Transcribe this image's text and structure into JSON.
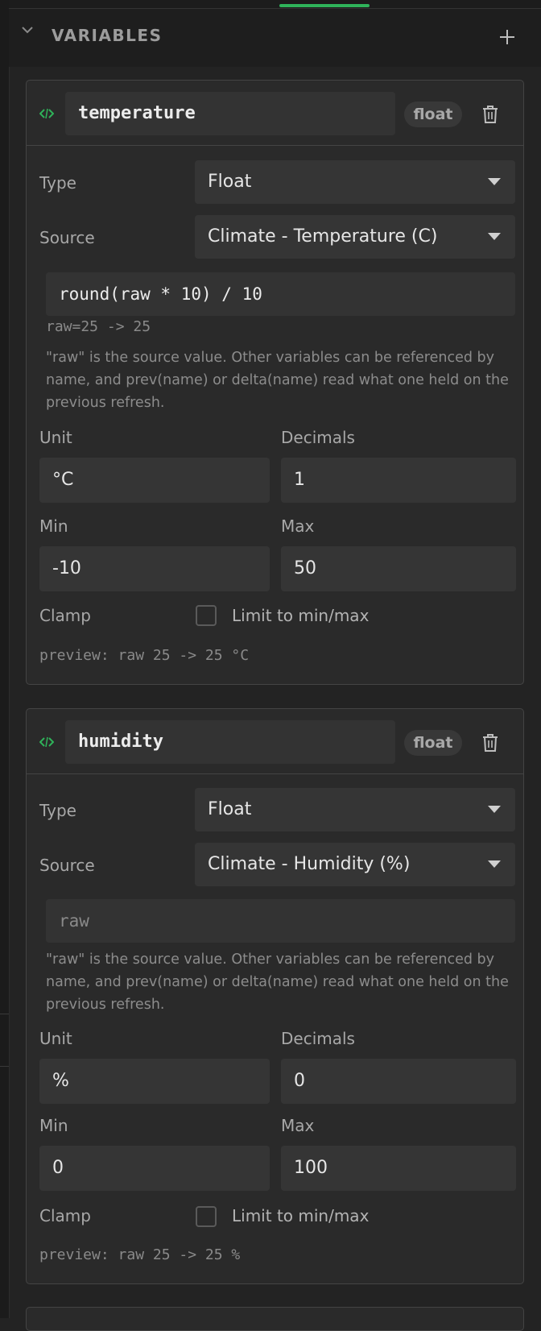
{
  "section": {
    "title": "VARIABLES"
  },
  "colors": {
    "accent": "#2fb35a"
  },
  "icons": {
    "collapse": "chevron-down-icon",
    "add": "plus-icon",
    "variable": "code-icon",
    "delete": "trash-icon"
  },
  "labels": {
    "type": "Type",
    "source": "Source",
    "unit": "Unit",
    "decimals": "Decimals",
    "min": "Min",
    "max": "Max",
    "clamp": "Clamp",
    "clamp_checkbox": "Limit to min/max"
  },
  "help_text": "\"raw\" is the source value. Other variables can be referenced by name, and prev(name) or delta(name) read what one held on the previous refresh.",
  "variables": [
    {
      "name": "temperature",
      "badge": "float",
      "type": "Float",
      "source": "Climate - Temperature (C)",
      "expression": "round(raw * 10) / 10",
      "evaluation": "raw=25 -> 25",
      "unit": "°C",
      "decimals": "1",
      "min": "-10",
      "max": "50",
      "clamp": false,
      "preview": "preview: raw 25 -> 25 °C"
    },
    {
      "name": "humidity",
      "badge": "float",
      "type": "Float",
      "source": "Climate - Humidity (%)",
      "expression": "",
      "expression_placeholder": "raw",
      "unit": "%",
      "decimals": "0",
      "min": "0",
      "max": "100",
      "clamp": false,
      "preview": "preview: raw 25 -> 25 %"
    }
  ]
}
